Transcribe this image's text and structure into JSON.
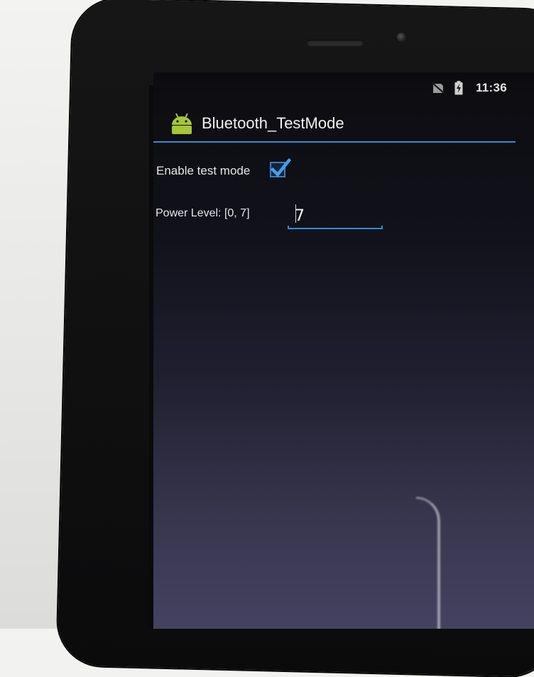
{
  "status_bar": {
    "time": "11:36",
    "icons": [
      "no-sim-icon",
      "battery-charging-icon"
    ]
  },
  "action_bar": {
    "icon": "android-icon",
    "title": "Bluetooth_TestMode",
    "accent_color": "#2f8fd8"
  },
  "settings": {
    "enable_label": "Enable test mode",
    "enable_checked": true,
    "power_label": "Power Level: [0, 7]",
    "power_value": "7"
  }
}
